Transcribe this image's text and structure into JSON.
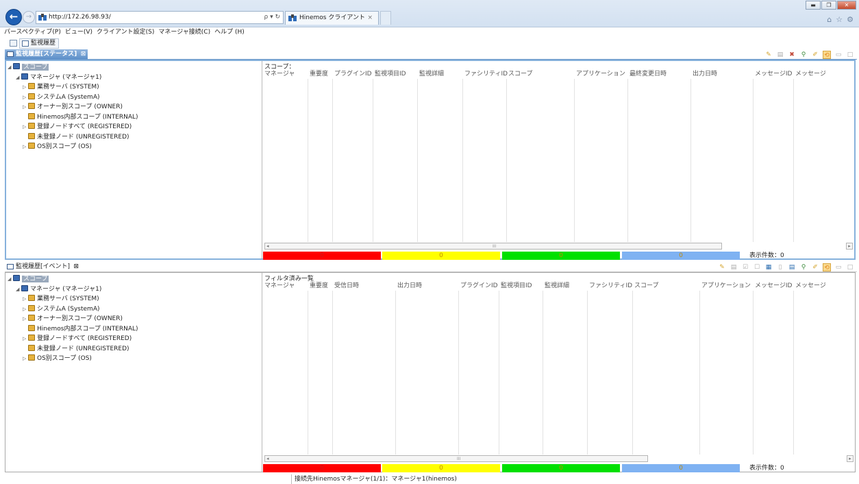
{
  "browser": {
    "url": "http://172.26.98.93/",
    "addr_tools": "ρ ▾ ↻",
    "tab_title": "Hinemos クライアント",
    "tab_close": "×",
    "back_glyph": "←",
    "forward_glyph": "→",
    "win_min": "▬",
    "win_restore": "❐",
    "win_close": "✕",
    "home_icon": "⌂",
    "star_icon": "☆",
    "gear_icon": "⚙"
  },
  "menu": [
    "パースペクティブ(P)",
    "ビュー(V)",
    "クライアント設定(S)",
    "マネージャ接続(C)",
    "ヘルプ (H)"
  ],
  "perspective": {
    "label": "監視履歴"
  },
  "status_view": {
    "tab_label": "監視履歴[ステータス]",
    "tab_close": "⊠",
    "scope_label": "スコープ：",
    "columns": [
      "マネージャ",
      "重要度",
      "プラグインID",
      "監視項目ID",
      "監視詳細",
      "ファシリティID",
      "スコープ",
      "アプリケーション",
      "最終変更日時",
      "出力日時",
      "メッセージID",
      "メッセージ"
    ],
    "counts": {
      "critical": "0",
      "warning": "0",
      "info": "0",
      "unknown": "0"
    },
    "display_count": "表示件数：0"
  },
  "event_view": {
    "tab_label": "監視履歴[イベント]",
    "tab_close": "⊠",
    "filter_label": "フィルタ済み一覧",
    "columns": [
      "マネージャ",
      "重要度",
      "受信日時",
      "出力日時",
      "プラグインID",
      "監視項目ID",
      "監視詳細",
      "ファシリティID",
      "スコープ",
      "アプリケーション",
      "メッセージID",
      "メッセージ"
    ],
    "counts": {
      "critical": "0",
      "warning": "0",
      "info": "0",
      "unknown": "0"
    },
    "display_count": "表示件数：0"
  },
  "tree": {
    "root": "スコープ",
    "manager": "マネージャ (マネージャ1)",
    "children": [
      "業務サーバ (SYSTEM)",
      "システムA (SystemA)",
      "オーナー別スコープ (OWNER)",
      "Hinemos内部スコープ (INTERNAL)",
      "登録ノードすべて (REGISTERED)",
      "未登録ノード (UNREGISTERED)",
      "OS別スコープ (OS)"
    ]
  },
  "scroll_marker": "III",
  "footer": "接続先Hinemosマネージャ(1/1)：マネージャ1(hinemos)",
  "colors": {
    "critical": "#ff0000",
    "warning": "#ffff00",
    "info": "#00e000",
    "unknown": "#7fb2f2",
    "accent": "#5b8ec8"
  }
}
